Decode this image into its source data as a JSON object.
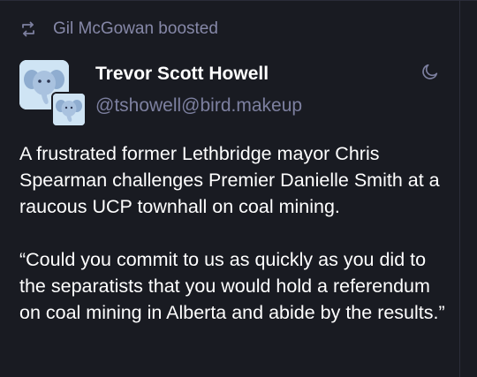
{
  "boost": {
    "icon": "boost-icon",
    "text": "Gil McGowan boosted"
  },
  "author": {
    "display_name": "Trevor Scott Howell",
    "handle": "@tshowell@bird.makeup",
    "avatar": "elephant-avatar",
    "visibility_icon": "moon-icon"
  },
  "post": {
    "paragraphs": [
      "A frustrated former Lethbridge mayor Chris Spearman challenges Premier Danielle Smith at a raucous UCP townhall on coal mining.",
      "“Could you commit to us as quickly as you did to the separatists that you would hold a referendum on coal mining in Alberta and abide by the results.”"
    ]
  },
  "colors": {
    "background": "#191b22",
    "text": "#ffffff",
    "muted": "#7d80a0",
    "boost": "#8688a8",
    "avatar_bg": "#cfe4f4",
    "elephant": "#9bb6d6"
  }
}
